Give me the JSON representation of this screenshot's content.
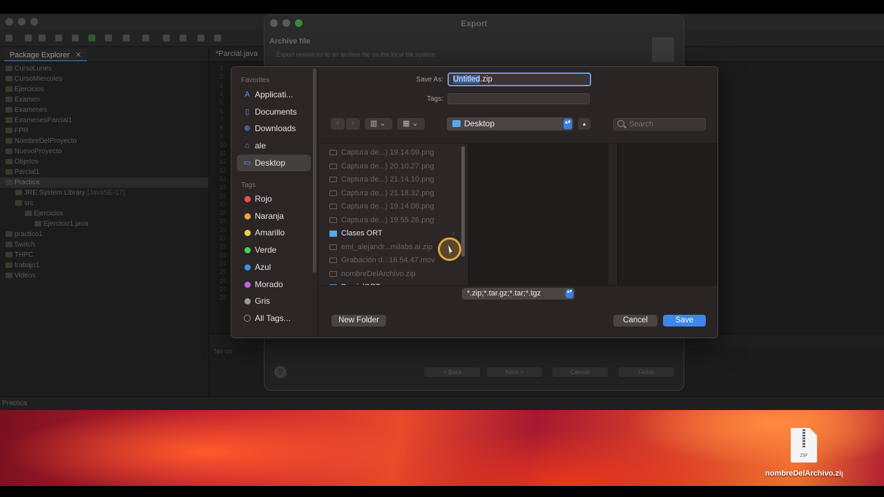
{
  "eclipse": {
    "package_explorer_tab": "Package Explorer",
    "tab_close": "✕",
    "editor_tab": "*Parcial.java",
    "line_numbers": [
      "1",
      "2",
      "3",
      "4",
      "5",
      "6",
      "7",
      "8",
      "9",
      "10",
      "11",
      "12",
      "13",
      "14",
      "15",
      "16",
      "17",
      "18",
      "19",
      "20",
      "21",
      "22",
      "23",
      "24",
      "25",
      "26",
      "27",
      "28"
    ],
    "tree": [
      {
        "label": "CursoLunes",
        "indent": 0
      },
      {
        "label": "CursoMiercoles",
        "indent": 0
      },
      {
        "label": "Ejercicios",
        "indent": 0
      },
      {
        "label": "Examen",
        "indent": 0
      },
      {
        "label": "Examenes",
        "indent": 0
      },
      {
        "label": "ExamenesParcial1",
        "indent": 0
      },
      {
        "label": "FPR",
        "indent": 0
      },
      {
        "label": "NombreDelProyecto",
        "indent": 0
      },
      {
        "label": "NuevoProyecto",
        "indent": 0
      },
      {
        "label": "Objetos",
        "indent": 0
      },
      {
        "label": "Parcial1",
        "indent": 0
      },
      {
        "label": "Practica",
        "indent": 0,
        "selected": true
      },
      {
        "label": "JRE System Library",
        "decoration": "[JavaSE-17]",
        "indent": 1
      },
      {
        "label": "src",
        "indent": 1
      },
      {
        "label": "Ejercicios",
        "indent": 2
      },
      {
        "label": "Ejercicio1.java",
        "indent": 3
      },
      {
        "label": "practico1",
        "indent": 0
      },
      {
        "label": "Switch",
        "indent": 0
      },
      {
        "label": "THPC",
        "indent": 0
      },
      {
        "label": "trabajo1",
        "indent": 0
      },
      {
        "label": "Videos",
        "indent": 0
      }
    ],
    "console_text": "No co",
    "status_text": "Practica"
  },
  "export_wizard": {
    "title": "Export",
    "heading": "Archive file",
    "description": "Export resources to an archive file on the local file system.",
    "help_label": "?",
    "buttons": {
      "back": "< Back",
      "next": "Next >",
      "cancel": "Cancel",
      "finish": "Finish"
    }
  },
  "save_sheet": {
    "sidebar": {
      "favorites_heading": "Favorites",
      "favorites": [
        {
          "label": "Applicati...",
          "icon": "applications-icon",
          "glyph": "A"
        },
        {
          "label": "Documents",
          "icon": "documents-icon",
          "glyph": "▯"
        },
        {
          "label": "Downloads",
          "icon": "downloads-icon",
          "glyph": "⊕"
        },
        {
          "label": "ale",
          "icon": "home-icon",
          "glyph": "⌂"
        },
        {
          "label": "Desktop",
          "icon": "desktop-icon",
          "glyph": "▭",
          "selected": true
        }
      ],
      "tags_heading": "Tags",
      "tags": [
        {
          "label": "Rojo",
          "color": "#f0504a"
        },
        {
          "label": "Naranja",
          "color": "#f2a23c"
        },
        {
          "label": "Amarillo",
          "color": "#f5d33e"
        },
        {
          "label": "Verde",
          "color": "#4fcf5a"
        },
        {
          "label": "Azul",
          "color": "#3e8ff0"
        },
        {
          "label": "Morado",
          "color": "#c265d8"
        },
        {
          "label": "Gris",
          "color": "#9a9a9a"
        },
        {
          "label": "All Tags...",
          "color": "ring"
        }
      ]
    },
    "save_as_label": "Save As:",
    "save_as_selected": "Untitled",
    "save_as_ext": ".zip",
    "tags_label": "Tags:",
    "back_arrow": "‹",
    "forward_arrow": "›",
    "view_glyph": "▥ ⌄",
    "group_glyph": "▦ ⌄",
    "location": "Desktop",
    "updown_glyph": "▴▾",
    "expand_glyph": "▴",
    "search_placeholder": "Search",
    "files": [
      {
        "name": "Captura de...) 19.14.09.png",
        "type": "file"
      },
      {
        "name": "Captura de...) 20.10.27.png",
        "type": "file"
      },
      {
        "name": "Captura de...) 21.14.10.png",
        "type": "file"
      },
      {
        "name": "Captura de...) 21.18.32.png",
        "type": "file"
      },
      {
        "name": "Captura de...) 19.14.08.png",
        "type": "file"
      },
      {
        "name": "Captura de...) 19.55.26.png",
        "type": "file"
      },
      {
        "name": "Clases ORT",
        "type": "folder"
      },
      {
        "name": "emi_alejandr...milabs.ai.zip",
        "type": "file"
      },
      {
        "name": "Grabación d...16.54.47.mov",
        "type": "file"
      },
      {
        "name": "nombreDelArchivo.zip",
        "type": "file"
      },
      {
        "name": "ParcialORT",
        "type": "folder"
      }
    ],
    "folder_chevron": "›",
    "file_format": "*.zip;*.tar.gz;*.tar;*.tgz",
    "new_folder_label": "New Folder",
    "cancel_label": "Cancel",
    "save_label": "Save"
  },
  "desktop": {
    "file_name": "nombreDelArchivo.zip",
    "file_icon_label": "ZIP"
  },
  "colors": {
    "accent": "#3d86ec",
    "focus_ring": "#5ea1ee",
    "cursor_highlight": "#e2a83a"
  }
}
